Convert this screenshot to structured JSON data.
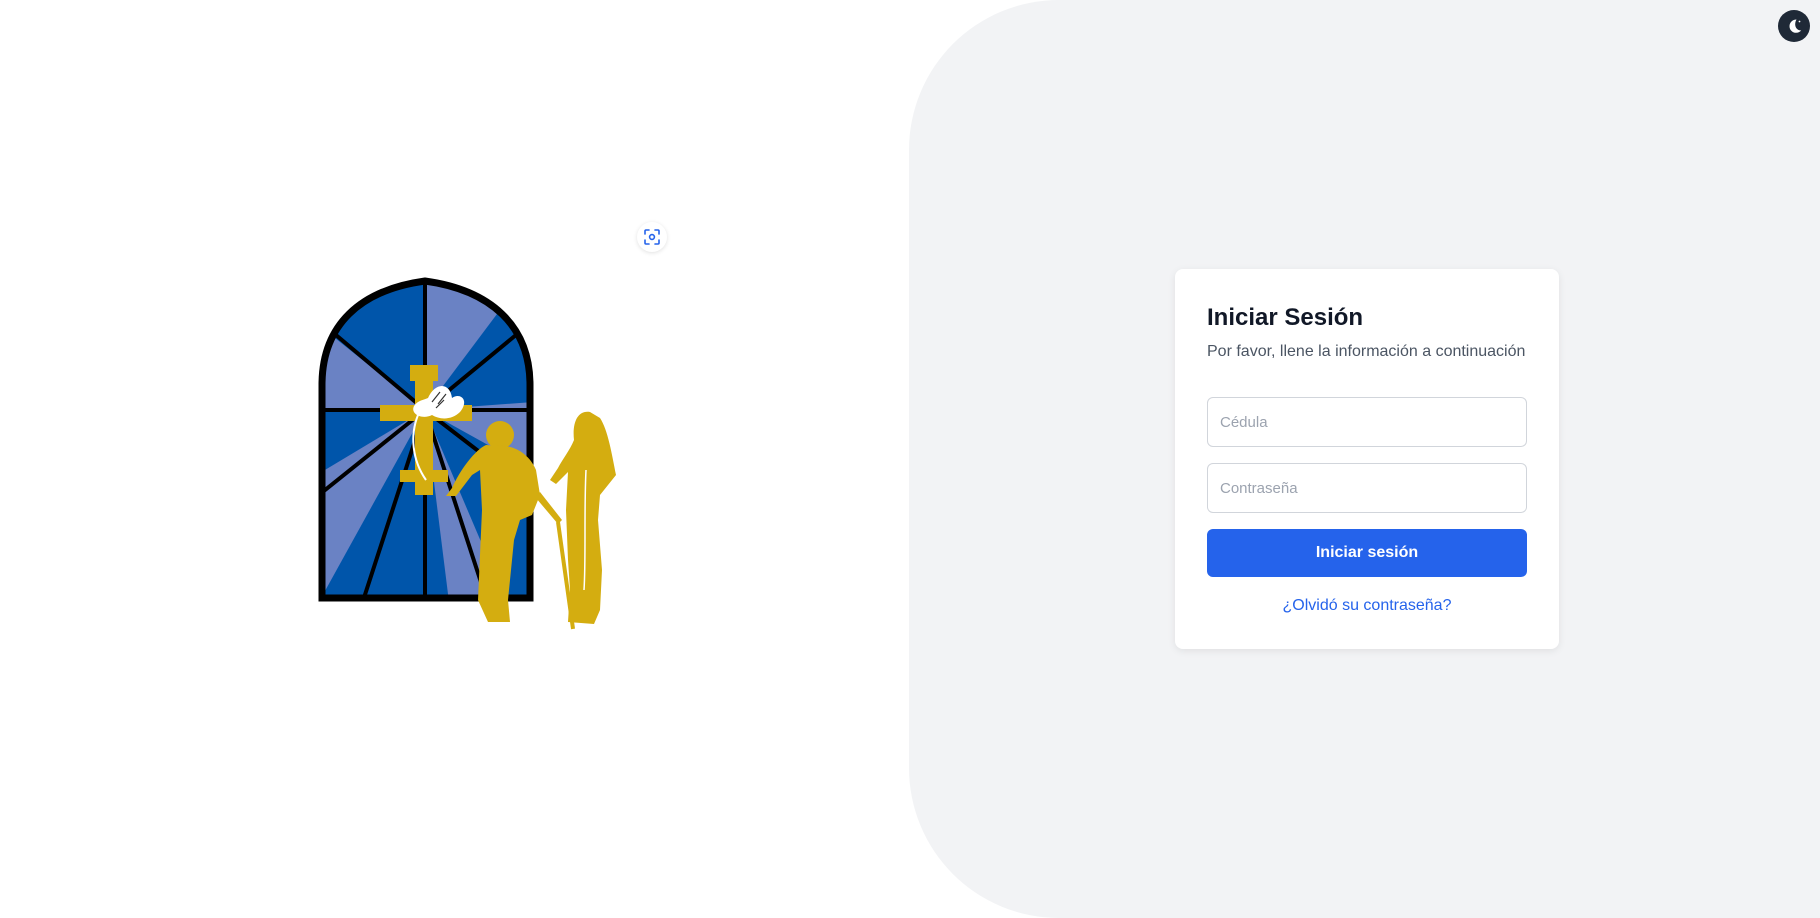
{
  "login": {
    "title": "Iniciar Sesión",
    "subtitle": "Por favor, llene la información a continuación",
    "cedula_placeholder": "Cédula",
    "cedula_value": "",
    "password_placeholder": "Contraseña",
    "password_value": "",
    "submit_label": "Iniciar sesión",
    "forgot_label": "¿Olvidó su contraseña?"
  },
  "icons": {
    "theme_toggle": "moon-icon",
    "capture": "scan-icon",
    "logo": "stained-glass-window-logo"
  },
  "colors": {
    "primary": "#2563eb",
    "window_dark_blue": "#0055aa",
    "window_light_blue": "#6a82c4",
    "gold": "#d4ad10",
    "right_background": "#f2f3f5"
  }
}
